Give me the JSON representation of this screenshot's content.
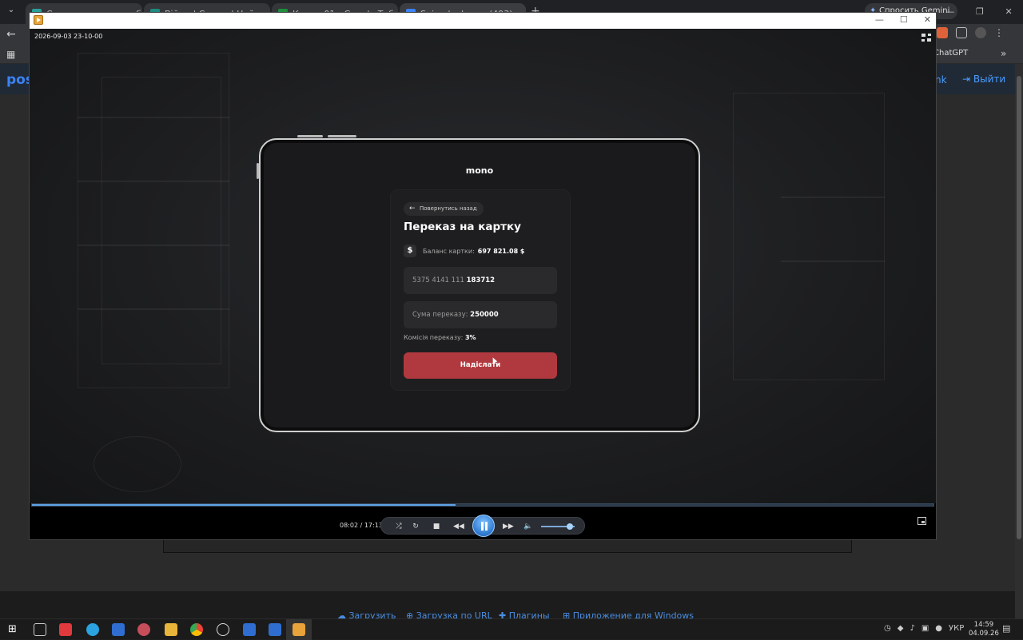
{
  "browser": {
    "tabs": [
      {
        "label": "Система клановых бафів та ві...",
        "color": "#2aa198"
      },
      {
        "label": "Війни | Союзи | Нейтралітет |...",
        "color": "#1e8a80"
      },
      {
        "label": "Клани 01 - Google Таблиці",
        "color": "#1e8e3e"
      },
      {
        "label": "Snimok ekrana (493) — Postim...",
        "color": "#3b82f6"
      }
    ],
    "gemini_label": "Спросить Gemini",
    "bookmark_chatgpt": "ChatGPT"
  },
  "site": {
    "logo": "pos",
    "link_label": "nk",
    "logout_label": "Выйти",
    "footer_links": [
      "Загрузить",
      "Загрузка по URL",
      "Плагины",
      "Приложение для Windows"
    ]
  },
  "player": {
    "timestamp": "2026-09-03 23-10-00",
    "time_display": "08:02 / 17:13",
    "progress": 0.47,
    "volume": 0.85
  },
  "app": {
    "brand": "mono",
    "back_label": "Повернутись назад",
    "title": "Переказ на картку",
    "balance_label": "Баланс картки:",
    "balance_value": "697 821.08 $",
    "card_prefix": "5375 4141 111",
    "card_suffix": "183712",
    "amount_label": "Сума переказу:",
    "amount_value": "250000",
    "fee_label": "Комісія переказу:",
    "fee_value": "3%",
    "send_label": "Надіслати"
  },
  "taskbar": {
    "lang": "УКР",
    "time": "14:59",
    "date": "04.09.26"
  },
  "colors": {
    "send_button": "#b0393f",
    "accent_blue": "#3b82f6"
  }
}
